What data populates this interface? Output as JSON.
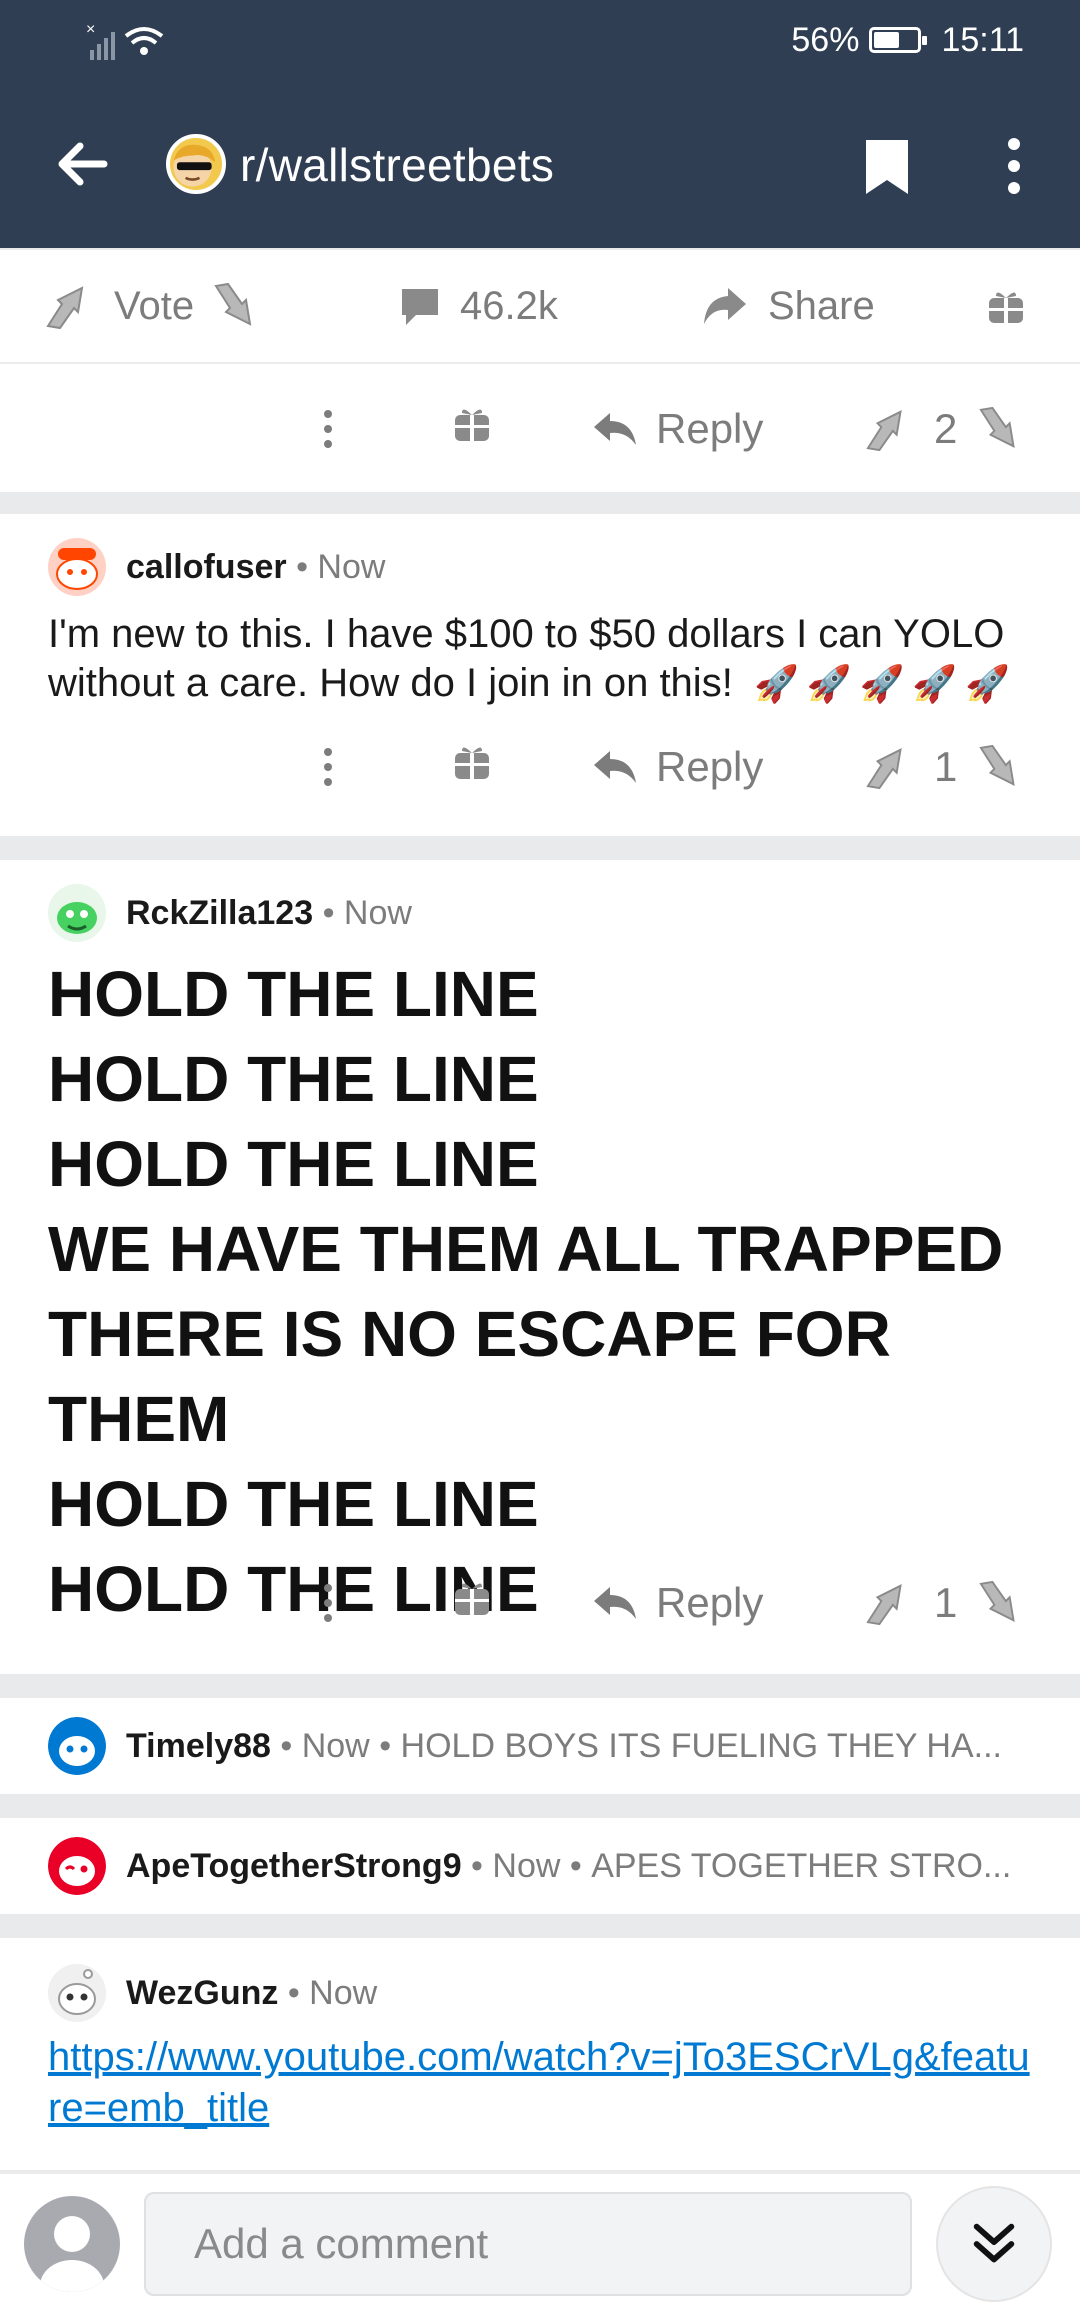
{
  "status_bar": {
    "battery_text": "56%",
    "battery_level": 0.56,
    "time": "15:11"
  },
  "header": {
    "subreddit": "r/wallstreetbets",
    "back_icon": "arrow-left-icon",
    "bookmark_icon": "bookmark-icon",
    "more_icon": "more-vertical-icon"
  },
  "post_actions": {
    "vote_label": "Vote",
    "comments_count": "46.2k",
    "share_label": "Share"
  },
  "comments": [
    {
      "reply_label": "Reply",
      "score": "2"
    },
    {
      "username": "callofuser",
      "time": "Now",
      "text": "I'm new to this. I have $100 to $50 dollars I can YOLO without a care. How do I join in on this!",
      "emojis": "🚀🚀🚀🚀🚀",
      "reply_label": "Reply",
      "score": "1",
      "avatar_color": "#ff4500"
    },
    {
      "username": "RckZilla123",
      "time": "Now",
      "lines": [
        "HOLD THE LINE",
        "HOLD THE LINE",
        "HOLD THE LINE",
        "WE HAVE THEM ALL TRAPPED",
        "THERE IS NO ESCAPE FOR THEM",
        "HOLD THE LINE",
        "HOLD THE LINE"
      ],
      "reply_label": "Reply",
      "score": "1",
      "avatar_color": "#46d160"
    },
    {
      "username": "Timely88",
      "time": "Now",
      "preview": "HOLD BOYS ITS FUELING THEY HA...",
      "avatar_color": "#0079d3"
    },
    {
      "username": "ApeTogetherStrong9",
      "time": "Now",
      "preview": "APES TOGETHER STRO...",
      "avatar_color": "#ea0027"
    },
    {
      "username": "WezGunz",
      "time": "Now",
      "link": "https://www.youtube.com/watch?v=jTo3ESCrVLg&feature=emb_title",
      "avatar_color": "#d7dadc"
    }
  ],
  "bottom_bar": {
    "placeholder": "Add a comment"
  }
}
